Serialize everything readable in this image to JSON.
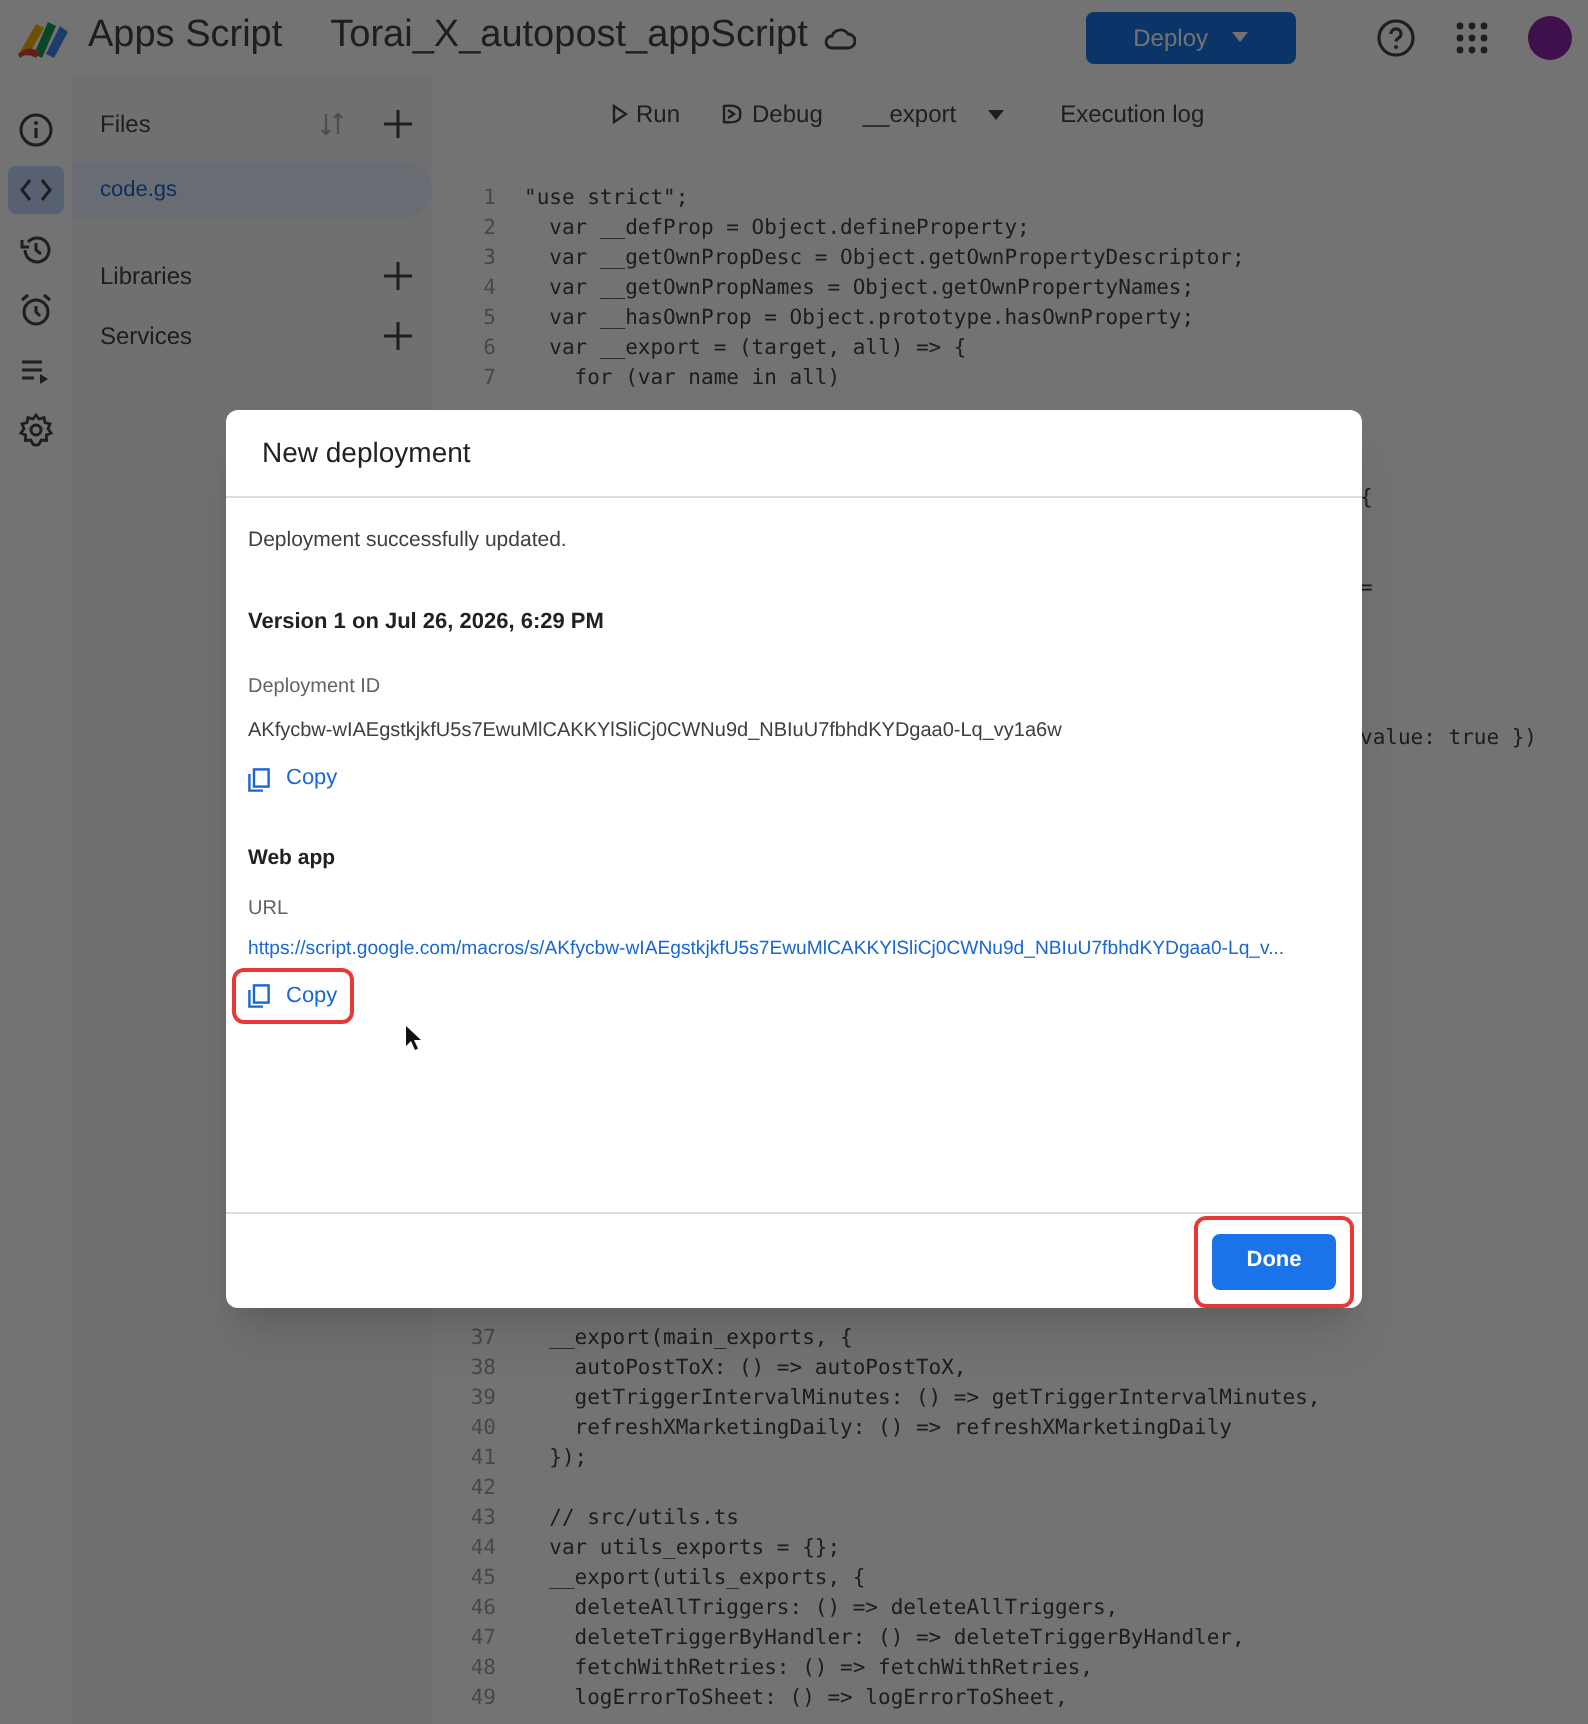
{
  "header": {
    "product": "Apps Script",
    "project_title": "Torai_X_autopost_appScript",
    "deploy_button": "Deploy"
  },
  "rail": [
    {
      "selected": false
    },
    {
      "selected": true
    },
    {
      "selected": false
    },
    {
      "selected": false
    },
    {
      "selected": false
    },
    {
      "selected": false
    }
  ],
  "files_panel": {
    "sections": [
      {
        "label": "Files",
        "kind": "files"
      },
      {
        "label": "Libraries",
        "kind": "plain"
      },
      {
        "label": "Services",
        "kind": "plain"
      }
    ],
    "files": [
      {
        "name": "code.gs",
        "selected": true
      }
    ]
  },
  "toolbar": {
    "run": "Run",
    "debug": "Debug",
    "function": "__export",
    "execution_log": "Execution log"
  },
  "code": {
    "lines": [
      {
        "number": "1",
        "text": "\"use strict\";"
      },
      {
        "number": "2",
        "text": "  var __defProp = Object.defineProperty;"
      },
      {
        "number": "3",
        "text": "  var __getOwnPropDesc = Object.getOwnPropertyDescriptor;"
      },
      {
        "number": "4",
        "text": "  var __getOwnPropNames = Object.getOwnPropertyNames;"
      },
      {
        "number": "5",
        "text": "  var __hasOwnProp = Object.prototype.hasOwnProperty;"
      },
      {
        "number": "6",
        "text": "  var __export = (target, all) => {"
      },
      {
        "number": "7",
        "text": "    for (var name in all)"
      },
      {
        "fragment": "{"
      },
      {
        "fragment": "="
      },
      {
        "fragment": "value: true })"
      },
      {
        "number": "37",
        "text": "  __export(main_exports, {"
      },
      {
        "number": "38",
        "text": "    autoPostToX: () => autoPostToX,"
      },
      {
        "number": "39",
        "text": "    getTriggerIntervalMinutes: () => getTriggerIntervalMinutes,"
      },
      {
        "number": "40",
        "text": "    refreshXMarketingDaily: () => refreshXMarketingDaily"
      },
      {
        "number": "41",
        "text": "  });"
      },
      {
        "number": "42"
      },
      {
        "number": "43",
        "text": "  // src/utils.ts"
      },
      {
        "number": "44",
        "text": "  var utils_exports = {};"
      },
      {
        "number": "45",
        "text": "  __export(utils_exports, {"
      },
      {
        "number": "46",
        "text": "    deleteAllTriggers: () => deleteAllTriggers,"
      },
      {
        "number": "47",
        "text": "    deleteTriggerByHandler: () => deleteTriggerByHandler,"
      },
      {
        "number": "48",
        "text": "    fetchWithRetries: () => fetchWithRetries,"
      },
      {
        "number": "49",
        "text": "    logErrorToSheet: () => logErrorToSheet,"
      }
    ]
  },
  "dialog": {
    "title": "New deployment",
    "message": "Deployment successfully updated.",
    "version": "Version 1 on Jul 26, 2026, 6:29 PM",
    "fields": [
      {
        "kind": "id",
        "label": "Deployment ID",
        "value": "AKfycbw-wIAEgstkjkfU5s7EwuMlCAKKYlSliCj0CWNu9d_NBIuU7fbhdKYDgaa0-Lq_vy1a6w",
        "copy": "Copy",
        "highlighted": false
      },
      {
        "kind": "section",
        "heading": "Web app"
      },
      {
        "kind": "link",
        "label": "URL",
        "value": "https://script.google.com/macros/s/AKfycbw-wIAEgstkjkfU5s7EwuMlCAKKYlSliCj0CWNu9d_NBIuU7fbhdKYDgaa0-Lq_v...",
        "copy": "Copy",
        "highlighted": true
      }
    ],
    "done": {
      "label": "Done",
      "highlighted": true
    }
  }
}
